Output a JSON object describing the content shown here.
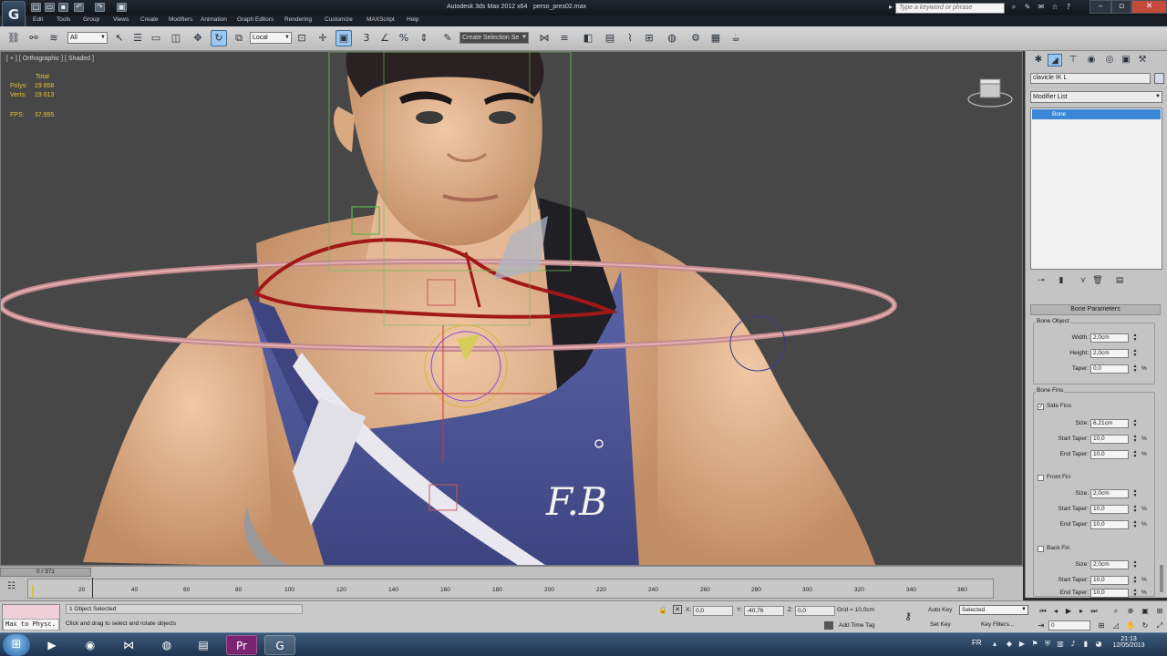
{
  "window": {
    "title": "Autodesk 3ds Max  2012 x64",
    "file": "perso_pres02.max",
    "search_placeholder": "Type a keyword or phrase",
    "app_logo": "3ds-max-logo-icon"
  },
  "menu": [
    "Edit",
    "Tools",
    "Group",
    "Views",
    "Create",
    "Modifiers",
    "Animation",
    "Graph Editors",
    "Rendering",
    "Customize",
    "MAXScript",
    "Help"
  ],
  "toolbar": {
    "selection_filter": "All",
    "ref_coord": "Local",
    "named_selection": "Create Selection Se"
  },
  "viewport": {
    "label": "[ + ] [ Orthographic ] [ Shaded ]",
    "stats": {
      "total_label": "Total",
      "polys_label": "Polys:",
      "polys_value": "19 858",
      "verts_label": "Verts:",
      "verts_value": "19 613",
      "fps_label": "FPS:",
      "fps_value": "37,995"
    },
    "shirt_logo": "F.B"
  },
  "command_panel": {
    "object_name": "clavicle IK L",
    "modifier_list": "Modifier List",
    "stack_item": "Bone",
    "rollout_title": "Bone Parameters",
    "bone_object": {
      "group_label": "Bone Object",
      "width_label": "Width:",
      "width": "2,0cm",
      "height_label": "Height:",
      "height": "2,0cm",
      "taper_label": "Taper:",
      "taper": "0,0",
      "taper_unit": "%"
    },
    "bone_fins": {
      "group_label": "Bone Fins",
      "side_fins_label": "Side Fins",
      "side_size": "6,21cm",
      "side_start_taper": "10,0",
      "side_end_taper": "10,0",
      "front_fin_label": "Front Fin",
      "front_size": "2,0cm",
      "front_start_taper": "10,0",
      "front_end_taper": "10,0",
      "back_fin_label": "Back Fin",
      "back_size": "2,0cm",
      "back_start_taper": "10,0",
      "back_end_taper": "10,0",
      "size_label": "Size:",
      "start_taper_label": "Start Taper:",
      "end_taper_label": "End Taper:",
      "unit": "%"
    }
  },
  "timeline": {
    "slider": "0 / 371",
    "ticks": [
      "20",
      "40",
      "60",
      "80",
      "100",
      "120",
      "140",
      "160",
      "180",
      "200",
      "220",
      "240",
      "260",
      "280",
      "300",
      "320",
      "340",
      "360"
    ]
  },
  "status": {
    "listener_text": "Max to Physc.",
    "selection": "1 Object Selected",
    "prompt": "Click and drag to select and rotate objects",
    "x_label": "X:",
    "x": "0,0",
    "y_label": "Y:",
    "y": "-40,76",
    "z_label": "Z:",
    "z": "0,0",
    "grid": "Grid = 10,0cm",
    "add_time_tag": "Add Time Tag",
    "auto_key": "Auto Key",
    "set_key": "Set Key",
    "selected": "Selected",
    "key_filters": "Key Filters...",
    "frame": "0"
  },
  "taskbar": {
    "lang": "FR",
    "time": "21:13",
    "date": "12/05/2013"
  }
}
